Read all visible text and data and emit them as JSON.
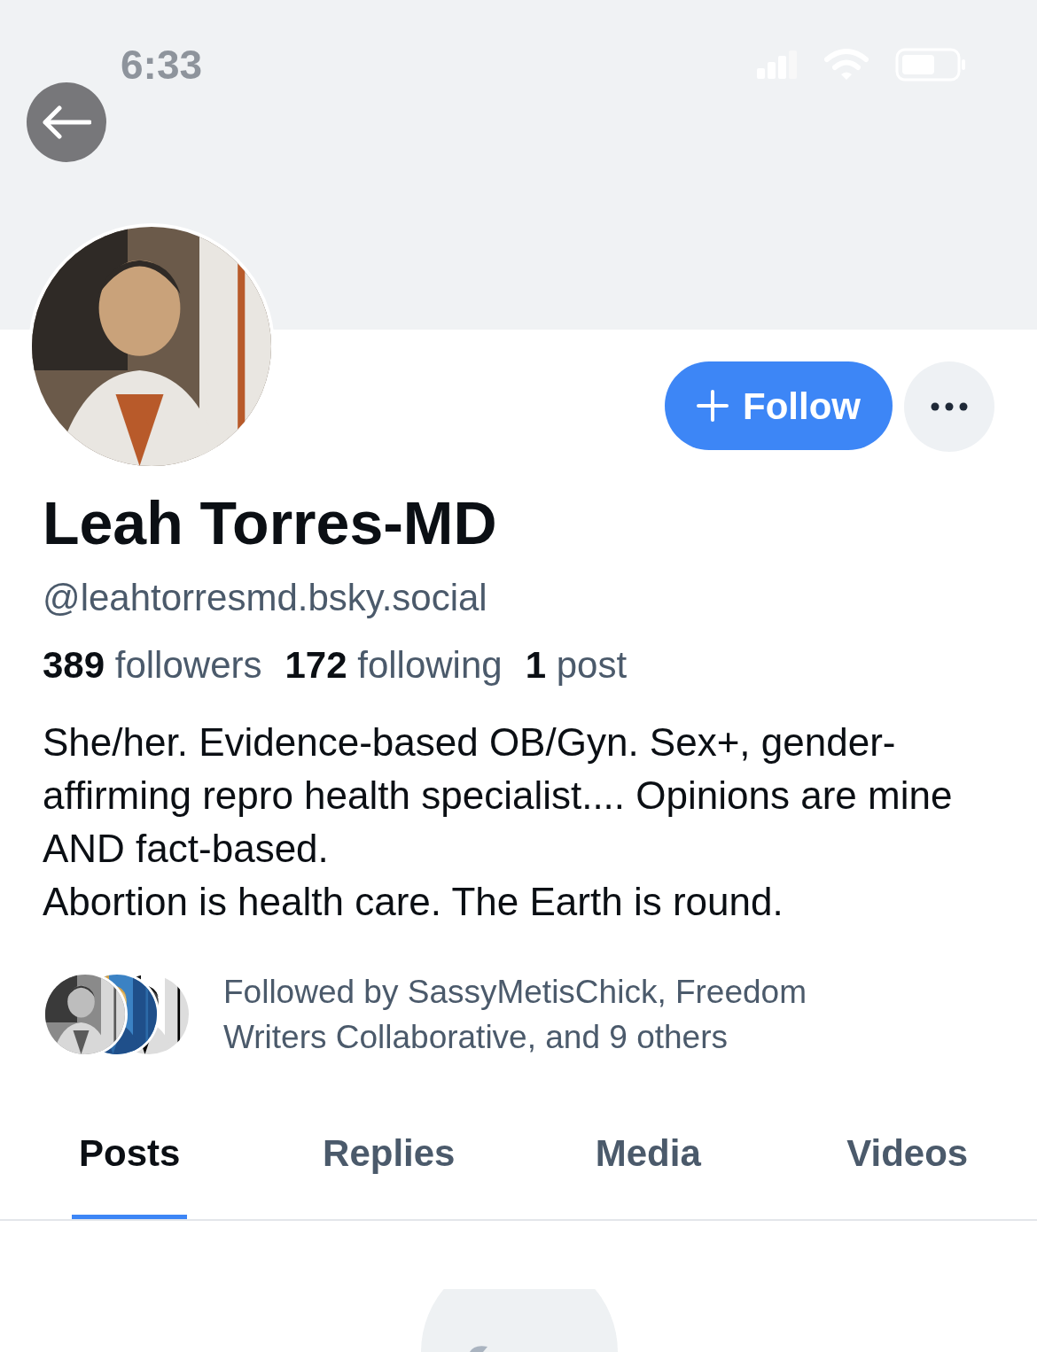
{
  "status_bar": {
    "time": "6:33"
  },
  "profile": {
    "name": "Leah Torres-MD",
    "handle": "@leahtorresmd.bsky.social",
    "following_state": false,
    "follow_label": "Follow"
  },
  "stats": [
    {
      "count": "389",
      "label": "followers"
    },
    {
      "count": "172",
      "label": "following"
    },
    {
      "count": "1",
      "label": "post"
    }
  ],
  "bio": "She/her. Evidence-based OB/Gyn. Sex+, gender-affirming repro health specialist.... Opinions are mine AND fact-based.\nAbortion is health care. The Earth is round.",
  "followed_by": {
    "text": "Followed by SassyMetisChick, Freedom Writers Collaborative, and 9 others"
  },
  "tabs": [
    {
      "label": "Posts",
      "selected": true
    },
    {
      "label": "Replies",
      "selected": false
    },
    {
      "label": "Media",
      "selected": false
    },
    {
      "label": "Videos",
      "selected": false
    }
  ]
}
